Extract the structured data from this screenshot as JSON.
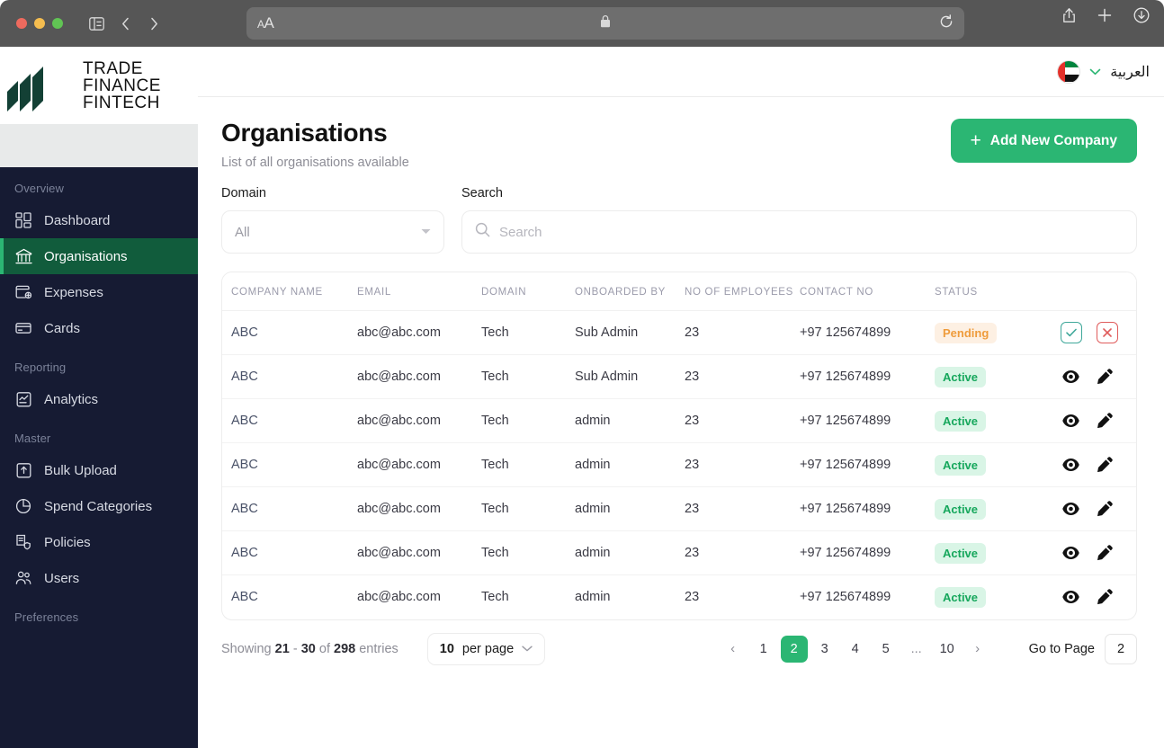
{
  "browser": {
    "controls": {
      "sidebar_toggle": "sidebar-toggle",
      "back": "‹",
      "forward": "›",
      "text_size": "AA",
      "reload": "reload",
      "share": "share",
      "new_tab": "+",
      "downloads": "downloads"
    },
    "url": ""
  },
  "logo": {
    "line1": "TRADE",
    "line2": "FINANCE",
    "line3": "FINTECH",
    "mark_color": "#134035"
  },
  "sidebar": {
    "sections": [
      {
        "label": "Overview",
        "items": [
          {
            "label": "Dashboard",
            "icon": "dashboard-icon",
            "active": false
          },
          {
            "label": "Organisations",
            "icon": "bank-icon",
            "active": true
          },
          {
            "label": "Expenses",
            "icon": "wallet-icon",
            "active": false
          },
          {
            "label": "Cards",
            "icon": "card-icon",
            "active": false
          }
        ]
      },
      {
        "label": "Reporting",
        "items": [
          {
            "label": "Analytics",
            "icon": "report-icon",
            "active": false
          }
        ]
      },
      {
        "label": "Master",
        "items": [
          {
            "label": "Bulk Upload",
            "icon": "upload-icon",
            "active": false
          },
          {
            "label": "Spend Categories",
            "icon": "pie-chart-icon",
            "active": false
          },
          {
            "label": "Policies",
            "icon": "policy-shield-icon",
            "active": false
          },
          {
            "label": "Users",
            "icon": "users-icon",
            "active": false
          }
        ]
      },
      {
        "label": "Preferences",
        "items": []
      }
    ],
    "active_bg": "#115c3c",
    "accent": "#2bb673"
  },
  "topbar": {
    "language": "العربية",
    "flag": "uae-flag-icon",
    "caret": "chevron-down-icon"
  },
  "header": {
    "title": "Organisations",
    "subtitle": "List of all organisations available",
    "add_button": "Add New Company",
    "add_button_color": "#2bb673"
  },
  "filters": {
    "domain": {
      "label": "Domain",
      "value": "All",
      "options": [
        "All"
      ]
    },
    "search": {
      "label": "Search",
      "placeholder": "Search",
      "value": ""
    }
  },
  "table": {
    "columns": [
      "COMPANY NAME",
      "EMAIL",
      "DOMAIN",
      "ONBOARDED BY",
      "NO OF EMPLOYEES",
      "CONTACT NO",
      "STATUS",
      ""
    ],
    "rows": [
      {
        "company": "ABC",
        "email": "abc@abc.com",
        "domain": "Tech",
        "onboarded_by": "Sub Admin",
        "employees": "23",
        "contact": "+97 125674899",
        "status": "Pending",
        "status_type": "pending",
        "actions": [
          "approve",
          "reject"
        ]
      },
      {
        "company": "ABC",
        "email": "abc@abc.com",
        "domain": "Tech",
        "onboarded_by": "Sub Admin",
        "employees": "23",
        "contact": "+97 125674899",
        "status": "Active",
        "status_type": "active",
        "actions": [
          "view",
          "edit"
        ]
      },
      {
        "company": "ABC",
        "email": "abc@abc.com",
        "domain": "Tech",
        "onboarded_by": "admin",
        "employees": "23",
        "contact": "+97 125674899",
        "status": "Active",
        "status_type": "active",
        "actions": [
          "view",
          "edit"
        ]
      },
      {
        "company": "ABC",
        "email": "abc@abc.com",
        "domain": "Tech",
        "onboarded_by": "admin",
        "employees": "23",
        "contact": "+97 125674899",
        "status": "Active",
        "status_type": "active",
        "actions": [
          "view",
          "edit"
        ]
      },
      {
        "company": "ABC",
        "email": "abc@abc.com",
        "domain": "Tech",
        "onboarded_by": "admin",
        "employees": "23",
        "contact": "+97 125674899",
        "status": "Active",
        "status_type": "active",
        "actions": [
          "view",
          "edit"
        ]
      },
      {
        "company": "ABC",
        "email": "abc@abc.com",
        "domain": "Tech",
        "onboarded_by": "admin",
        "employees": "23",
        "contact": "+97 125674899",
        "status": "Active",
        "status_type": "active",
        "actions": [
          "view",
          "edit"
        ]
      },
      {
        "company": "ABC",
        "email": "abc@abc.com",
        "domain": "Tech",
        "onboarded_by": "admin",
        "employees": "23",
        "contact": "+97 125674899",
        "status": "Active",
        "status_type": "active",
        "actions": [
          "view",
          "edit"
        ]
      }
    ]
  },
  "footer": {
    "showing_prefix": "Showing",
    "range_from": "21",
    "range_dash": "-",
    "range_to": "30",
    "of_word": "of",
    "total": "298",
    "entries_word": "entries",
    "per_page_count": "10",
    "per_page_label": "per page",
    "pagination": {
      "prev": "‹",
      "next": "›",
      "pages": [
        "1",
        "2",
        "3",
        "4",
        "5",
        "...",
        "10"
      ],
      "current": "2"
    },
    "goto_label": "Go to Page",
    "goto_value": "2"
  }
}
